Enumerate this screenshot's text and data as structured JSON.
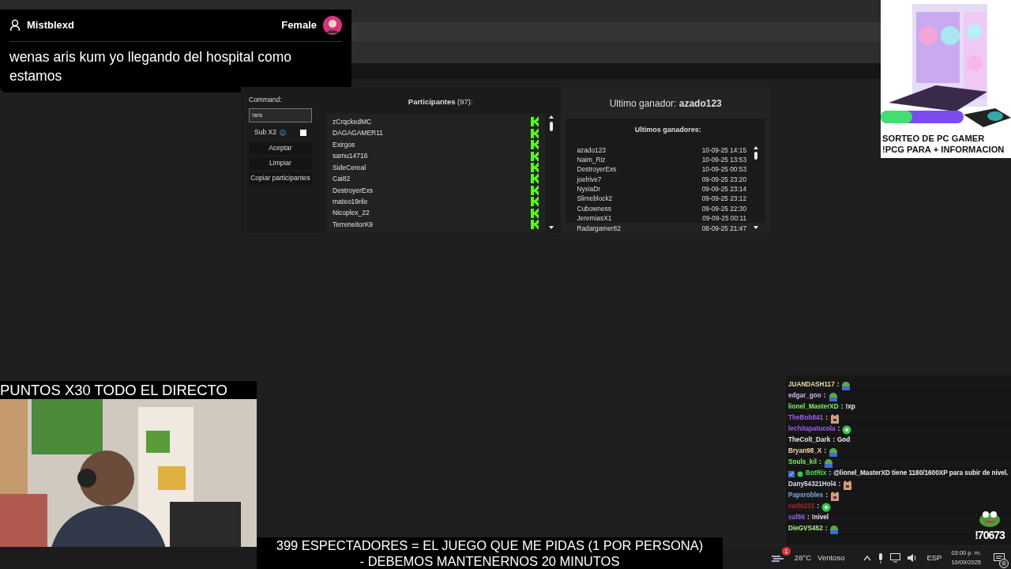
{
  "message_overlay": {
    "username": "Mistblexd",
    "gender": "Female",
    "text": "wenas aris kum yo llegando del hospital como estamos"
  },
  "giveaway": {
    "command_label": "Command:",
    "command_value": "!aris",
    "sub_option": {
      "label": "Sub X2",
      "checked": false
    },
    "buttons": [
      "Aceptar",
      "Limpiar",
      "Copiar participantes"
    ],
    "participants_heading": "**Participantes** (97):",
    "participants": [
      "zCrqckedMC",
      "DAGAGAMER11",
      "Exirgos",
      "samu14716",
      "SideCereal",
      "Cai82",
      "DestroyerExs",
      "mateo19rile",
      "Nicoplex_22",
      "TerreneitorK9"
    ],
    "last_winner": "Ultimo ganador: **azado123**",
    "winners_heading": "Ultimos ganadores:",
    "winners": [
      {
        "name": "azado123",
        "date": "10-09-25 14:15"
      },
      {
        "name": "Naim_Riz",
        "date": "10-09-25 13:53"
      },
      {
        "name": "DestroyerExs",
        "date": "10-09-25 00:53"
      },
      {
        "name": "joelrive7",
        "date": "09-09-25 23:20"
      },
      {
        "name": "NyxiaDr",
        "date": "09-09-25 23:14"
      },
      {
        "name": "Slimeblock2",
        "date": "09-09-25 23:12"
      },
      {
        "name": "Cubowness",
        "date": "09-09-25 22:30"
      },
      {
        "name": "JeremiasX1",
        "date": "09-09-25 00:11"
      },
      {
        "name": "Radargamer82",
        "date": "08-09-25 21:47"
      }
    ]
  },
  "ad": {
    "lines": [
      "SORTEO DE PC GAMER",
      "!PCG PARA + INFORMACION"
    ]
  },
  "webcam": {
    "title": "PUNTOS X30 TODO EL DIRECTO",
    "kind": "picture"
  },
  "chat": [
    {
      "user": "JUANDASH117",
      "separator": ":",
      "color": "#f0d9a8",
      "kind": "frog"
    },
    {
      "user": "edgar_goo",
      "separator": ":",
      "color": "#c9b3f0",
      "kind": "frog"
    },
    {
      "user": "lionel_MasterXD",
      "separator": ":",
      "color": "#7cf06a",
      "kind": "text",
      "text": "!xp"
    },
    {
      "user": "TheBob841",
      "separator": ":",
      "color": "#a05cf0",
      "kind": "cat"
    },
    {
      "user": "lechitapatucola",
      "separator": ":",
      "color": "#a05cf0",
      "kind": "blob"
    },
    {
      "user": "TheColt_Dark",
      "separator": ":",
      "color": "#e6e6e6",
      "kind": "text",
      "text": "God"
    },
    {
      "user": "Bryan98_X",
      "separator": ":",
      "color": "#f0d9a8",
      "kind": "frog"
    },
    {
      "user": "Souls_kil",
      "separator": ":",
      "color": "#7cf06a",
      "kind": "frog"
    },
    {
      "user": "BotRix",
      "separator": ":",
      "color": "#52e052",
      "kind": "bot",
      "text": "@lionel_MasterXD tiene 1180/1600XP para subir de nivel."
    },
    {
      "user": "Dany54321Hol4",
      "separator": ":",
      "color": "#d8d8f0",
      "kind": "cat"
    },
    {
      "user": "Papsrobles",
      "separator": ":",
      "color": "#7fa8e0",
      "kind": "cat"
    },
    {
      "user": "rachi231",
      "separator": ":",
      "color": "#c02020",
      "kind": "blob"
    },
    {
      "user": "saf86",
      "separator": ":",
      "color": "#a05cf0",
      "kind": "text",
      "text": "!nivel"
    },
    {
      "user": "DieGVS452",
      "separator": ":",
      "color": "#a8f08c",
      "kind": "frog"
    }
  ],
  "counter": "!70673",
  "caption": [
    "399 ESPECTADORES = EL JUEGO QUE ME PIDAS (1 POR PERSONA)",
    "- DEBEMOS MANTENERNOS 20 MINUTOS"
  ],
  "taskbar": {
    "weather_badge": "1",
    "temperature": "28°C",
    "weather": "Ventoso",
    "language": "ESP",
    "time": "03:00 p. m.",
    "date": "10/09/2025",
    "notifications": "8"
  }
}
